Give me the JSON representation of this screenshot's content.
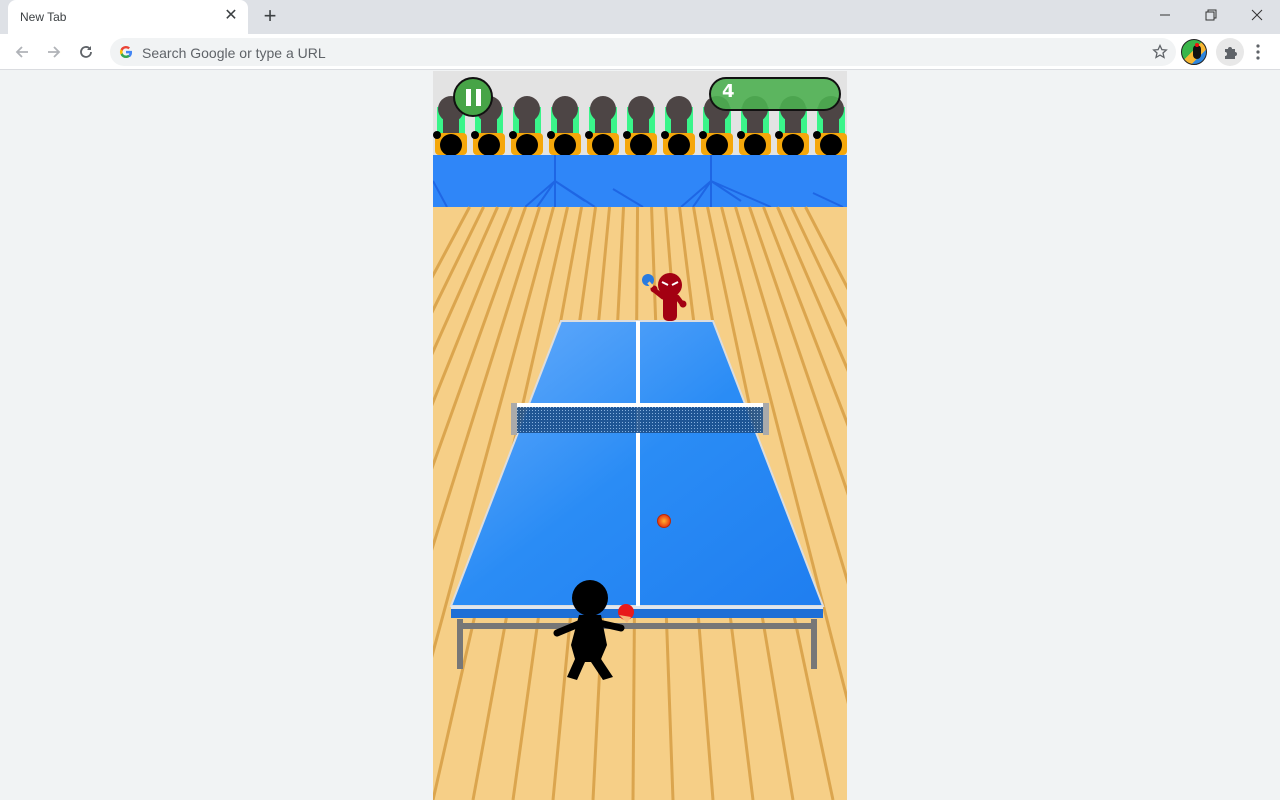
{
  "browser": {
    "tab": {
      "title": "New Tab",
      "close_icon": "close-icon"
    },
    "new_tab_label": "+",
    "omnibox": {
      "placeholder": "Search Google or type a URL",
      "value": ""
    },
    "window_controls": [
      "minimize",
      "restore",
      "close"
    ]
  },
  "game": {
    "score": "4",
    "pause_icon": "pause-icon",
    "colors": {
      "table": "#2a8cf5",
      "floor": "#f6cf87",
      "banner": "#2f86f8",
      "opponent": "#a30012",
      "player": "#000000",
      "ball": "#f25a14",
      "hud_green": "#4caf50"
    }
  }
}
